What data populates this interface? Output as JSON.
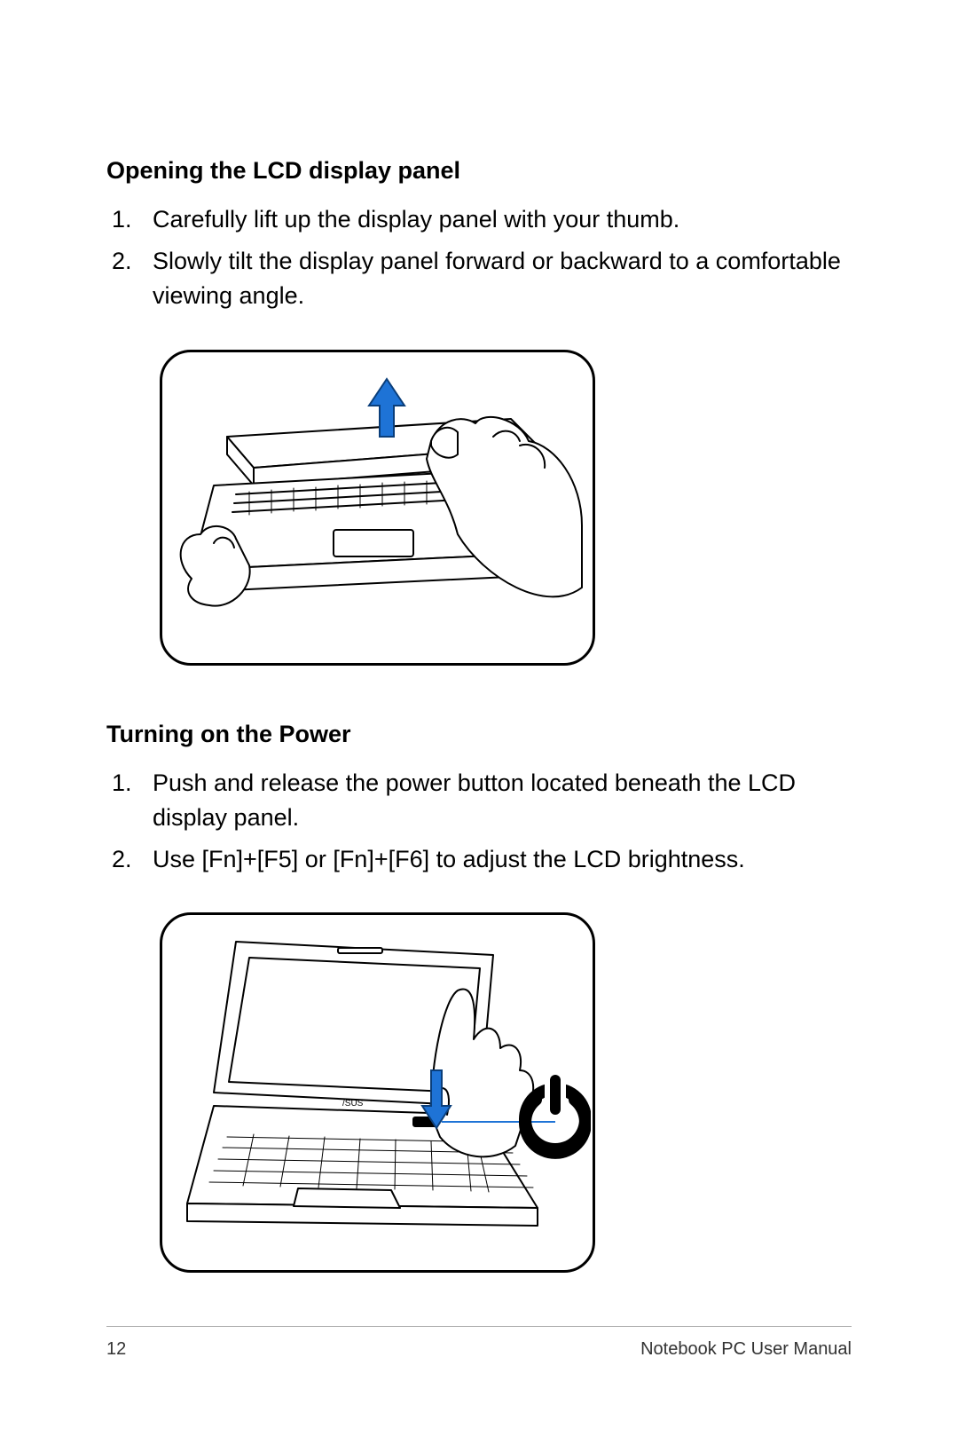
{
  "section1": {
    "heading": "Opening the LCD display panel",
    "steps": [
      "Carefully lift up the display panel with your thumb.",
      "Slowly tilt the display panel forward or backward to a comfortable viewing angle."
    ]
  },
  "section2": {
    "heading": "Turning on the Power",
    "steps": [
      "Push and release the power button located beneath the LCD display panel.",
      "Use [Fn]+[F5] or [Fn]+[F6] to adjust the LCD brightness."
    ]
  },
  "footer": {
    "page_number": "12",
    "doc_title": "Notebook PC User Manual"
  }
}
